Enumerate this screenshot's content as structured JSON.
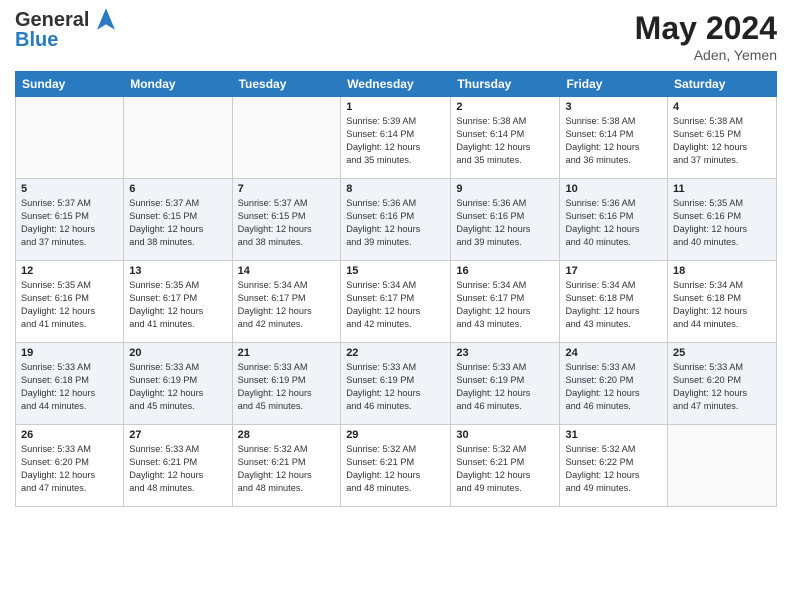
{
  "header": {
    "logo_line1": "General",
    "logo_line2": "Blue",
    "month": "May 2024",
    "location": "Aden, Yemen"
  },
  "days_of_week": [
    "Sunday",
    "Monday",
    "Tuesday",
    "Wednesday",
    "Thursday",
    "Friday",
    "Saturday"
  ],
  "weeks": [
    [
      {
        "day": "",
        "info": ""
      },
      {
        "day": "",
        "info": ""
      },
      {
        "day": "",
        "info": ""
      },
      {
        "day": "1",
        "info": "Sunrise: 5:39 AM\nSunset: 6:14 PM\nDaylight: 12 hours\nand 35 minutes."
      },
      {
        "day": "2",
        "info": "Sunrise: 5:38 AM\nSunset: 6:14 PM\nDaylight: 12 hours\nand 35 minutes."
      },
      {
        "day": "3",
        "info": "Sunrise: 5:38 AM\nSunset: 6:14 PM\nDaylight: 12 hours\nand 36 minutes."
      },
      {
        "day": "4",
        "info": "Sunrise: 5:38 AM\nSunset: 6:15 PM\nDaylight: 12 hours\nand 37 minutes."
      }
    ],
    [
      {
        "day": "5",
        "info": "Sunrise: 5:37 AM\nSunset: 6:15 PM\nDaylight: 12 hours\nand 37 minutes."
      },
      {
        "day": "6",
        "info": "Sunrise: 5:37 AM\nSunset: 6:15 PM\nDaylight: 12 hours\nand 38 minutes."
      },
      {
        "day": "7",
        "info": "Sunrise: 5:37 AM\nSunset: 6:15 PM\nDaylight: 12 hours\nand 38 minutes."
      },
      {
        "day": "8",
        "info": "Sunrise: 5:36 AM\nSunset: 6:16 PM\nDaylight: 12 hours\nand 39 minutes."
      },
      {
        "day": "9",
        "info": "Sunrise: 5:36 AM\nSunset: 6:16 PM\nDaylight: 12 hours\nand 39 minutes."
      },
      {
        "day": "10",
        "info": "Sunrise: 5:36 AM\nSunset: 6:16 PM\nDaylight: 12 hours\nand 40 minutes."
      },
      {
        "day": "11",
        "info": "Sunrise: 5:35 AM\nSunset: 6:16 PM\nDaylight: 12 hours\nand 40 minutes."
      }
    ],
    [
      {
        "day": "12",
        "info": "Sunrise: 5:35 AM\nSunset: 6:16 PM\nDaylight: 12 hours\nand 41 minutes."
      },
      {
        "day": "13",
        "info": "Sunrise: 5:35 AM\nSunset: 6:17 PM\nDaylight: 12 hours\nand 41 minutes."
      },
      {
        "day": "14",
        "info": "Sunrise: 5:34 AM\nSunset: 6:17 PM\nDaylight: 12 hours\nand 42 minutes."
      },
      {
        "day": "15",
        "info": "Sunrise: 5:34 AM\nSunset: 6:17 PM\nDaylight: 12 hours\nand 42 minutes."
      },
      {
        "day": "16",
        "info": "Sunrise: 5:34 AM\nSunset: 6:17 PM\nDaylight: 12 hours\nand 43 minutes."
      },
      {
        "day": "17",
        "info": "Sunrise: 5:34 AM\nSunset: 6:18 PM\nDaylight: 12 hours\nand 43 minutes."
      },
      {
        "day": "18",
        "info": "Sunrise: 5:34 AM\nSunset: 6:18 PM\nDaylight: 12 hours\nand 44 minutes."
      }
    ],
    [
      {
        "day": "19",
        "info": "Sunrise: 5:33 AM\nSunset: 6:18 PM\nDaylight: 12 hours\nand 44 minutes."
      },
      {
        "day": "20",
        "info": "Sunrise: 5:33 AM\nSunset: 6:19 PM\nDaylight: 12 hours\nand 45 minutes."
      },
      {
        "day": "21",
        "info": "Sunrise: 5:33 AM\nSunset: 6:19 PM\nDaylight: 12 hours\nand 45 minutes."
      },
      {
        "day": "22",
        "info": "Sunrise: 5:33 AM\nSunset: 6:19 PM\nDaylight: 12 hours\nand 46 minutes."
      },
      {
        "day": "23",
        "info": "Sunrise: 5:33 AM\nSunset: 6:19 PM\nDaylight: 12 hours\nand 46 minutes."
      },
      {
        "day": "24",
        "info": "Sunrise: 5:33 AM\nSunset: 6:20 PM\nDaylight: 12 hours\nand 46 minutes."
      },
      {
        "day": "25",
        "info": "Sunrise: 5:33 AM\nSunset: 6:20 PM\nDaylight: 12 hours\nand 47 minutes."
      }
    ],
    [
      {
        "day": "26",
        "info": "Sunrise: 5:33 AM\nSunset: 6:20 PM\nDaylight: 12 hours\nand 47 minutes."
      },
      {
        "day": "27",
        "info": "Sunrise: 5:33 AM\nSunset: 6:21 PM\nDaylight: 12 hours\nand 48 minutes."
      },
      {
        "day": "28",
        "info": "Sunrise: 5:32 AM\nSunset: 6:21 PM\nDaylight: 12 hours\nand 48 minutes."
      },
      {
        "day": "29",
        "info": "Sunrise: 5:32 AM\nSunset: 6:21 PM\nDaylight: 12 hours\nand 48 minutes."
      },
      {
        "day": "30",
        "info": "Sunrise: 5:32 AM\nSunset: 6:21 PM\nDaylight: 12 hours\nand 49 minutes."
      },
      {
        "day": "31",
        "info": "Sunrise: 5:32 AM\nSunset: 6:22 PM\nDaylight: 12 hours\nand 49 minutes."
      },
      {
        "day": "",
        "info": ""
      }
    ]
  ]
}
